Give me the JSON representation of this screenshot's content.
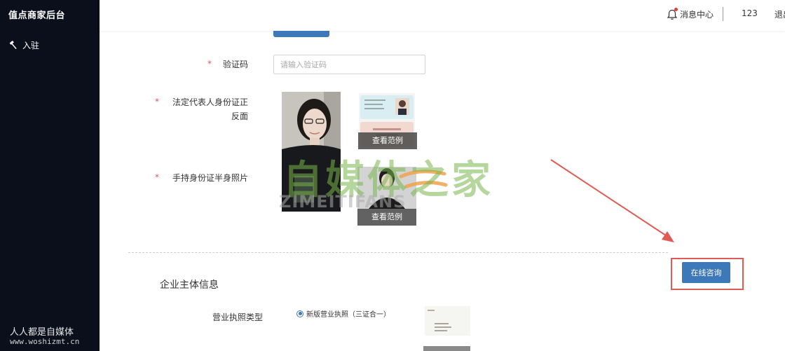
{
  "sidebar": {
    "brand": "值点商家后台",
    "nav_item_label": "入驻",
    "watermark_text": "人人都是自媒体",
    "watermark_url": "www.woshizmt.cn"
  },
  "topbar": {
    "message_center": "消息中心",
    "user_name": "123",
    "logout": "退出"
  },
  "form": {
    "captcha_label": "验证码",
    "captcha_placeholder": "请输入验证码",
    "captcha_value": "",
    "id_back_label_line1": "法定代表人身份证正",
    "id_back_label_line2": "反面",
    "handheld_label": "手持身份证半身照片",
    "required_mark": "*",
    "view_example_1": "查看范例",
    "view_example_2": "查看范例"
  },
  "enterprise": {
    "section_title": "企业主体信息",
    "license_type_label": "营业执照类型",
    "license_option": "新版营业执照（三证合一）"
  },
  "consult_button": "在线咨询",
  "watermark": {
    "chinese": "自媒体之家",
    "pinyin": "ZIMEITIFANS"
  },
  "colors": {
    "sidebar_bg": "#0b0f1c",
    "primary": "#3d78b8",
    "required": "#e0565b",
    "annotation": "#e05b55"
  }
}
